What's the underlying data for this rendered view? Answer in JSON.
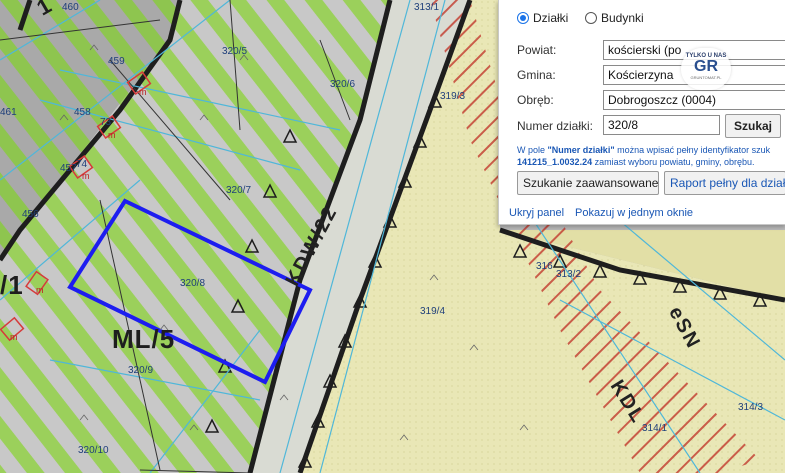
{
  "map": {
    "parcel_labels": [
      "460",
      "459",
      "458",
      "457",
      "456",
      "461",
      "320/5",
      "320/6",
      "320/7",
      "320/8",
      "320/9",
      "320/10",
      "313/1",
      "319/3",
      "316",
      "313/2",
      "319/4",
      "314/3",
      "314/1",
      "73",
      "74"
    ],
    "zone_labels": [
      "ML/5",
      "/1",
      "1"
    ],
    "road_labels": [
      "KDW/22",
      "KDL",
      "eSN"
    ],
    "small_marks": [
      "m",
      "m",
      "m",
      "m",
      "m"
    ],
    "colors": {
      "stripe_green": "#9bd05b",
      "stripe_gray": "#c8c8c8",
      "field_yellow": "#e9e7b6",
      "boundary_black": "#1e1e1e",
      "selection_blue": "#1d1df0",
      "cyan_line": "#4fb7d9",
      "red_hatch": "#c23a2e"
    }
  },
  "panel": {
    "radio_dzialki": "Działki",
    "radio_budynki": "Budynki",
    "powiat_label": "Powiat:",
    "powiat_value": "kościerski (po",
    "gmina_label": "Gmina:",
    "gmina_value": "Kościerzyna",
    "obreb_label": "Obręb:",
    "obreb_value": "Dobrogoszcz (0004)",
    "numer_label": "Numer działki:",
    "numer_value": "320/8",
    "search_button": "Szukaj",
    "hint_prefix": "W pole",
    "hint_field": "\"Numer działki\"",
    "hint_middle": "można wpisać pełny identyfikator szuk",
    "hint_id": "141215_1.0032.24",
    "hint_suffix": "zamiast wyboru powiatu, gminy, obrębu.",
    "advanced_button": "Szukanie zaawansowane",
    "report_button": "Raport pełny dla dział",
    "hide_link": "Ukryj panel",
    "window_link": "Pokazuj w jednym oknie"
  },
  "badge": {
    "top": "TYLKO U NAS",
    "main": "GR",
    "sub": "GRUNTOMAT.PL"
  }
}
